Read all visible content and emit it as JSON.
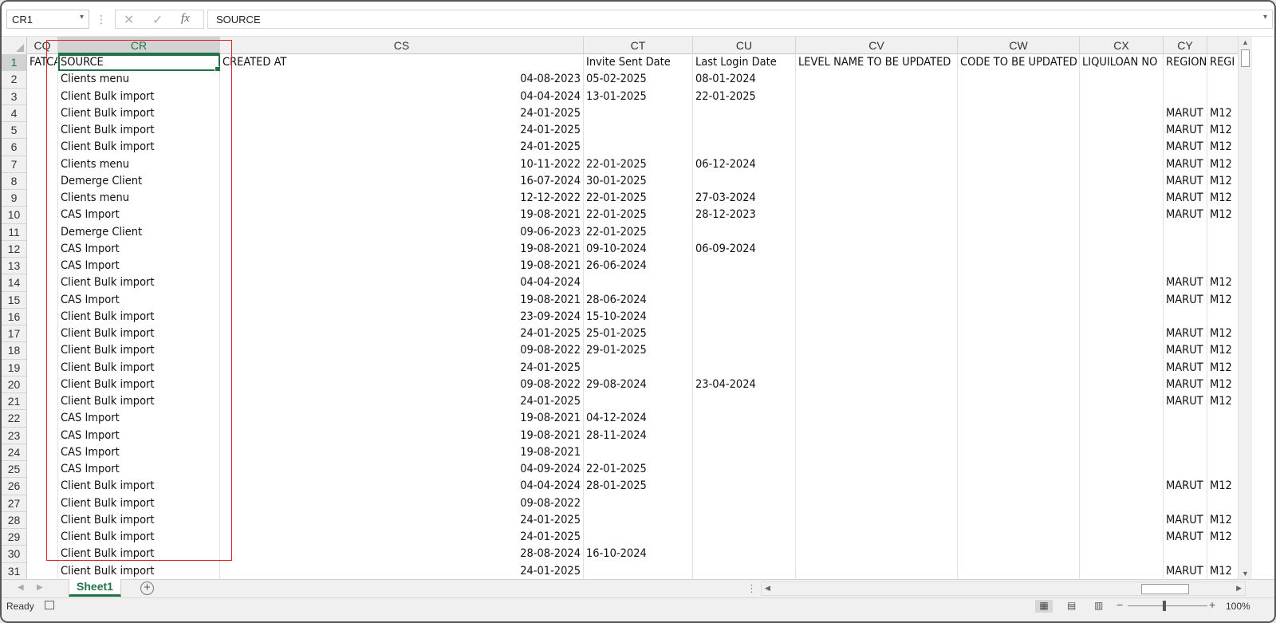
{
  "formula_bar": {
    "name_box": "CR1",
    "formula": "SOURCE"
  },
  "columns": [
    {
      "letter": "CQ"
    },
    {
      "letter": "CR"
    },
    {
      "letter": "CS"
    },
    {
      "letter": "CT"
    },
    {
      "letter": "CU"
    },
    {
      "letter": "CV"
    },
    {
      "letter": "CW"
    },
    {
      "letter": "CX"
    },
    {
      "letter": "CY"
    },
    {
      "letter": ""
    }
  ],
  "selected_column": "CR",
  "selected_row": 1,
  "rows": [
    {
      "num": "1",
      "cells": [
        "FATCA",
        "SOURCE",
        "CREATED AT",
        "Invite Sent Date",
        "Last Login Date",
        "LEVEL NAME TO BE UPDATED",
        "CODE TO BE UPDATED",
        "LIQUILOAN NO",
        "REGION",
        "REGI"
      ]
    },
    {
      "num": "2",
      "cells": [
        "",
        "Clients menu",
        "04-08-2023",
        "05-02-2025",
        "08-01-2024",
        "",
        "",
        "",
        "",
        ""
      ]
    },
    {
      "num": "3",
      "cells": [
        "",
        "Client Bulk import",
        "04-04-2024",
        "13-01-2025",
        "22-01-2025",
        "",
        "",
        "",
        "",
        ""
      ]
    },
    {
      "num": "4",
      "cells": [
        "",
        "Client Bulk import",
        "24-01-2025",
        "",
        "",
        "",
        "",
        "",
        "MARUT",
        "M12"
      ]
    },
    {
      "num": "5",
      "cells": [
        "",
        "Client Bulk import",
        "24-01-2025",
        "",
        "",
        "",
        "",
        "",
        "MARUT",
        "M12"
      ]
    },
    {
      "num": "6",
      "cells": [
        "",
        "Client Bulk import",
        "24-01-2025",
        "",
        "",
        "",
        "",
        "",
        "MARUT",
        "M12"
      ]
    },
    {
      "num": "7",
      "cells": [
        "",
        "Clients menu",
        "10-11-2022",
        "22-01-2025",
        "06-12-2024",
        "",
        "",
        "",
        "MARUT",
        "M12"
      ]
    },
    {
      "num": "8",
      "cells": [
        "",
        "Demerge Client",
        "16-07-2024",
        "30-01-2025",
        "",
        "",
        "",
        "",
        "MARUT",
        "M12"
      ]
    },
    {
      "num": "9",
      "cells": [
        "",
        "Clients menu",
        "12-12-2022",
        "22-01-2025",
        "27-03-2024",
        "",
        "",
        "",
        "MARUT",
        "M12"
      ]
    },
    {
      "num": "10",
      "cells": [
        "",
        "CAS Import",
        "19-08-2021",
        "22-01-2025",
        "28-12-2023",
        "",
        "",
        "",
        "MARUT",
        "M12"
      ]
    },
    {
      "num": "11",
      "cells": [
        "",
        "Demerge Client",
        "09-06-2023",
        "22-01-2025",
        "",
        "",
        "",
        "",
        "",
        ""
      ]
    },
    {
      "num": "12",
      "cells": [
        "",
        "CAS Import",
        "19-08-2021",
        "09-10-2024",
        "06-09-2024",
        "",
        "",
        "",
        "",
        ""
      ]
    },
    {
      "num": "13",
      "cells": [
        "",
        "CAS Import",
        "19-08-2021",
        "26-06-2024",
        "",
        "",
        "",
        "",
        "",
        ""
      ]
    },
    {
      "num": "14",
      "cells": [
        "",
        "Client Bulk import",
        "04-04-2024",
        "",
        "",
        "",
        "",
        "",
        "MARUT",
        "M12"
      ]
    },
    {
      "num": "15",
      "cells": [
        "",
        "CAS Import",
        "19-08-2021",
        "28-06-2024",
        "",
        "",
        "",
        "",
        "MARUT",
        "M12"
      ]
    },
    {
      "num": "16",
      "cells": [
        "",
        "Client Bulk import",
        "23-09-2024",
        "15-10-2024",
        "",
        "",
        "",
        "",
        "",
        ""
      ]
    },
    {
      "num": "17",
      "cells": [
        "",
        "Client Bulk import",
        "24-01-2025",
        "25-01-2025",
        "",
        "",
        "",
        "",
        "MARUT",
        "M12"
      ]
    },
    {
      "num": "18",
      "cells": [
        "",
        "Client Bulk import",
        "09-08-2022",
        "29-01-2025",
        "",
        "",
        "",
        "",
        "MARUT",
        "M12"
      ]
    },
    {
      "num": "19",
      "cells": [
        "",
        "Client Bulk import",
        "24-01-2025",
        "",
        "",
        "",
        "",
        "",
        "MARUT",
        "M12"
      ]
    },
    {
      "num": "20",
      "cells": [
        "",
        "Client Bulk import",
        "09-08-2022",
        "29-08-2024",
        "23-04-2024",
        "",
        "",
        "",
        "MARUT",
        "M12"
      ]
    },
    {
      "num": "21",
      "cells": [
        "",
        "Client Bulk import",
        "24-01-2025",
        "",
        "",
        "",
        "",
        "",
        "MARUT",
        "M12"
      ]
    },
    {
      "num": "22",
      "cells": [
        "",
        "CAS Import",
        "19-08-2021",
        "04-12-2024",
        "",
        "",
        "",
        "",
        "",
        ""
      ]
    },
    {
      "num": "23",
      "cells": [
        "",
        "CAS Import",
        "19-08-2021",
        "28-11-2024",
        "",
        "",
        "",
        "",
        "",
        ""
      ]
    },
    {
      "num": "24",
      "cells": [
        "",
        "CAS Import",
        "19-08-2021",
        "",
        "",
        "",
        "",
        "",
        "",
        ""
      ]
    },
    {
      "num": "25",
      "cells": [
        "",
        "CAS Import",
        "04-09-2024",
        "22-01-2025",
        "",
        "",
        "",
        "",
        "",
        ""
      ]
    },
    {
      "num": "26",
      "cells": [
        "",
        "Client Bulk import",
        "04-04-2024",
        "28-01-2025",
        "",
        "",
        "",
        "",
        "MARUT",
        "M12"
      ]
    },
    {
      "num": "27",
      "cells": [
        "",
        "Client Bulk import",
        "09-08-2022",
        "",
        "",
        "",
        "",
        "",
        "",
        ""
      ]
    },
    {
      "num": "28",
      "cells": [
        "",
        "Client Bulk import",
        "24-01-2025",
        "",
        "",
        "",
        "",
        "",
        "MARUT",
        "M12"
      ]
    },
    {
      "num": "29",
      "cells": [
        "",
        "Client Bulk import",
        "24-01-2025",
        "",
        "",
        "",
        "",
        "",
        "MARUT",
        "M12"
      ]
    },
    {
      "num": "30",
      "cells": [
        "",
        "Client Bulk import",
        "28-08-2024",
        "16-10-2024",
        "",
        "",
        "",
        "",
        "",
        ""
      ]
    },
    {
      "num": "31",
      "cells": [
        "",
        "Client Bulk import",
        "24-01-2025",
        "",
        "",
        "",
        "",
        "",
        "MARUT",
        "M12"
      ]
    }
  ],
  "sheet_tabs": [
    {
      "label": "Sheet1",
      "active": true
    }
  ],
  "status_bar": {
    "status": "Ready",
    "zoom": "100%"
  },
  "colors": {
    "accent": "#217346",
    "highlight_box": "#e02020"
  }
}
